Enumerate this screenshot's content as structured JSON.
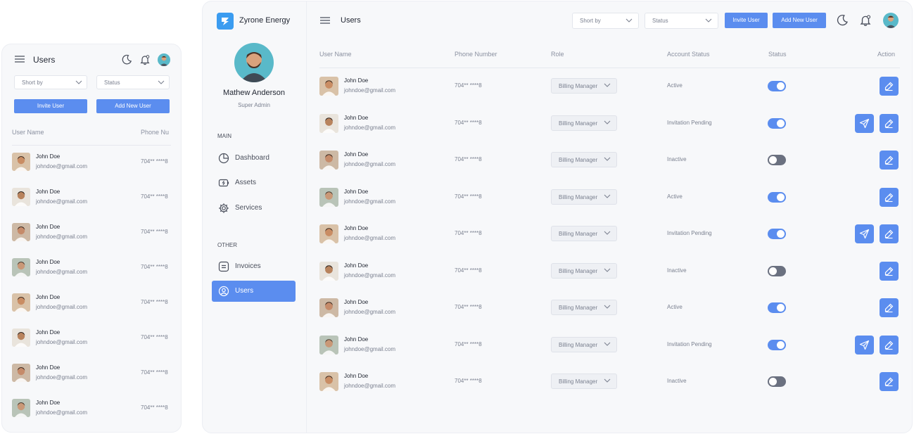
{
  "colors": {
    "accent": "#5b8def",
    "logo": "#3b9cf0",
    "toggle_on": "#5b8def",
    "toggle_off": "#6b7180"
  },
  "mobile": {
    "title": "Users",
    "sort_placeholder": "Short by",
    "status_placeholder": "Status",
    "invite_label": "Invite User",
    "add_label": "Add New User",
    "col_user": "User Name",
    "col_phone": "Phone Nu",
    "rows": [
      {
        "name": "John Doe",
        "email": "johndoe@gmail.com",
        "phone": "704** ****8"
      },
      {
        "name": "John Doe",
        "email": "johndoe@gmail.com",
        "phone": "704** ****8"
      },
      {
        "name": "John Doe",
        "email": "johndoe@gmail.com",
        "phone": "704** ****8"
      },
      {
        "name": "John Doe",
        "email": "johndoe@gmail.com",
        "phone": "704** ****8"
      },
      {
        "name": "John Doe",
        "email": "johndoe@gmail.com",
        "phone": "704** ****8"
      },
      {
        "name": "John Doe",
        "email": "johndoe@gmail.com",
        "phone": "704** ****8"
      },
      {
        "name": "John Doe",
        "email": "johndoe@gmail.com",
        "phone": "704** ****8"
      },
      {
        "name": "John Doe",
        "email": "johndoe@gmail.com",
        "phone": "704** ****8"
      }
    ]
  },
  "desktop": {
    "brand": "Zyrone Energy",
    "page_title": "Users",
    "sort_placeholder": "Short by",
    "status_placeholder": "Status",
    "invite_label": "Invite User",
    "add_label": "Add New User",
    "profile": {
      "name": "Mathew Anderson",
      "role": "Super Admin"
    },
    "section_main": "MAIN",
    "section_other": "OTHER",
    "nav": [
      {
        "label": "Dashboard",
        "icon": "pie-chart-icon"
      },
      {
        "label": "Assets",
        "icon": "battery-charge-icon"
      },
      {
        "label": "Services",
        "icon": "gear-icon"
      },
      {
        "label": "Invoices",
        "icon": "invoice-icon"
      },
      {
        "label": "Users",
        "icon": "users-icon"
      }
    ],
    "table": {
      "headers": [
        "User Name",
        "Phone Number",
        "Role",
        "Account Status",
        "Status",
        "Action"
      ],
      "rows": [
        {
          "name": "John Doe",
          "email": "johndoe@gmail.com",
          "phone": "704** ****8",
          "role": "Billing Manager",
          "account_status": "Active",
          "enabled": true,
          "send_invite": false
        },
        {
          "name": "John Doe",
          "email": "johndoe@gmail.com",
          "phone": "704** ****8",
          "role": "Billing Manager",
          "account_status": "Invitation Pending",
          "enabled": true,
          "send_invite": true
        },
        {
          "name": "John Doe",
          "email": "johndoe@gmail.com",
          "phone": "704** ****8",
          "role": "Billing Manager",
          "account_status": "Inactive",
          "enabled": false,
          "send_invite": false
        },
        {
          "name": "John Doe",
          "email": "johndoe@gmail.com",
          "phone": "704** ****8",
          "role": "Billing Manager",
          "account_status": "Active",
          "enabled": true,
          "send_invite": false
        },
        {
          "name": "John Doe",
          "email": "johndoe@gmail.com",
          "phone": "704** ****8",
          "role": "Billing Manager",
          "account_status": "Invitation Pending",
          "enabled": true,
          "send_invite": true
        },
        {
          "name": "John Doe",
          "email": "johndoe@gmail.com",
          "phone": "704** ****8",
          "role": "Billing Manager",
          "account_status": "Inactive",
          "enabled": false,
          "send_invite": false
        },
        {
          "name": "John Doe",
          "email": "johndoe@gmail.com",
          "phone": "704** ****8",
          "role": "Billing Manager",
          "account_status": "Active",
          "enabled": true,
          "send_invite": false
        },
        {
          "name": "John Doe",
          "email": "johndoe@gmail.com",
          "phone": "704** ****8",
          "role": "Billing Manager",
          "account_status": "Invitation Pending",
          "enabled": true,
          "send_invite": true
        },
        {
          "name": "John Doe",
          "email": "johndoe@gmail.com",
          "phone": "704** ****8",
          "role": "Billing Manager",
          "account_status": "Inactive",
          "enabled": false,
          "send_invite": false
        }
      ]
    }
  }
}
